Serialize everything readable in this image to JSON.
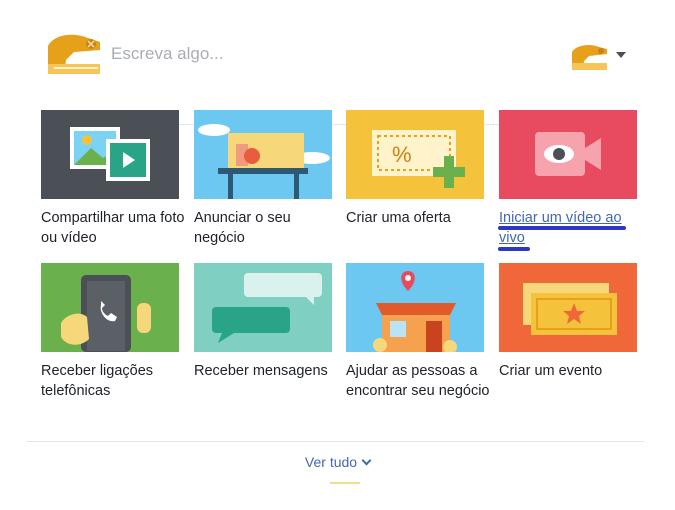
{
  "composer": {
    "placeholder": "Escreva algo..."
  },
  "tiles": [
    {
      "label": "Compartilhar uma foto ou vídeo",
      "color": "#4b4f56"
    },
    {
      "label": "Anunciar o seu negócio",
      "color": "#6cc8f0"
    },
    {
      "label": "Criar uma oferta",
      "color": "#f5c33b"
    },
    {
      "label": "Iniciar um vídeo ao vivo",
      "color": "#e84a5f"
    },
    {
      "label": "Receber ligações telefônicas",
      "color": "#6ab04c"
    },
    {
      "label": "Receber mensagens",
      "color": "#7fcfc3"
    },
    {
      "label": "Ajudar as pessoas a encontrar seu negócio",
      "color": "#6cc8f0"
    },
    {
      "label": "Criar um evento",
      "color": "#f0683a"
    }
  ],
  "footer": {
    "see_all": "Ver tudo"
  },
  "colors": {
    "link": "#4267b2",
    "annotation": "#2e36c8"
  }
}
